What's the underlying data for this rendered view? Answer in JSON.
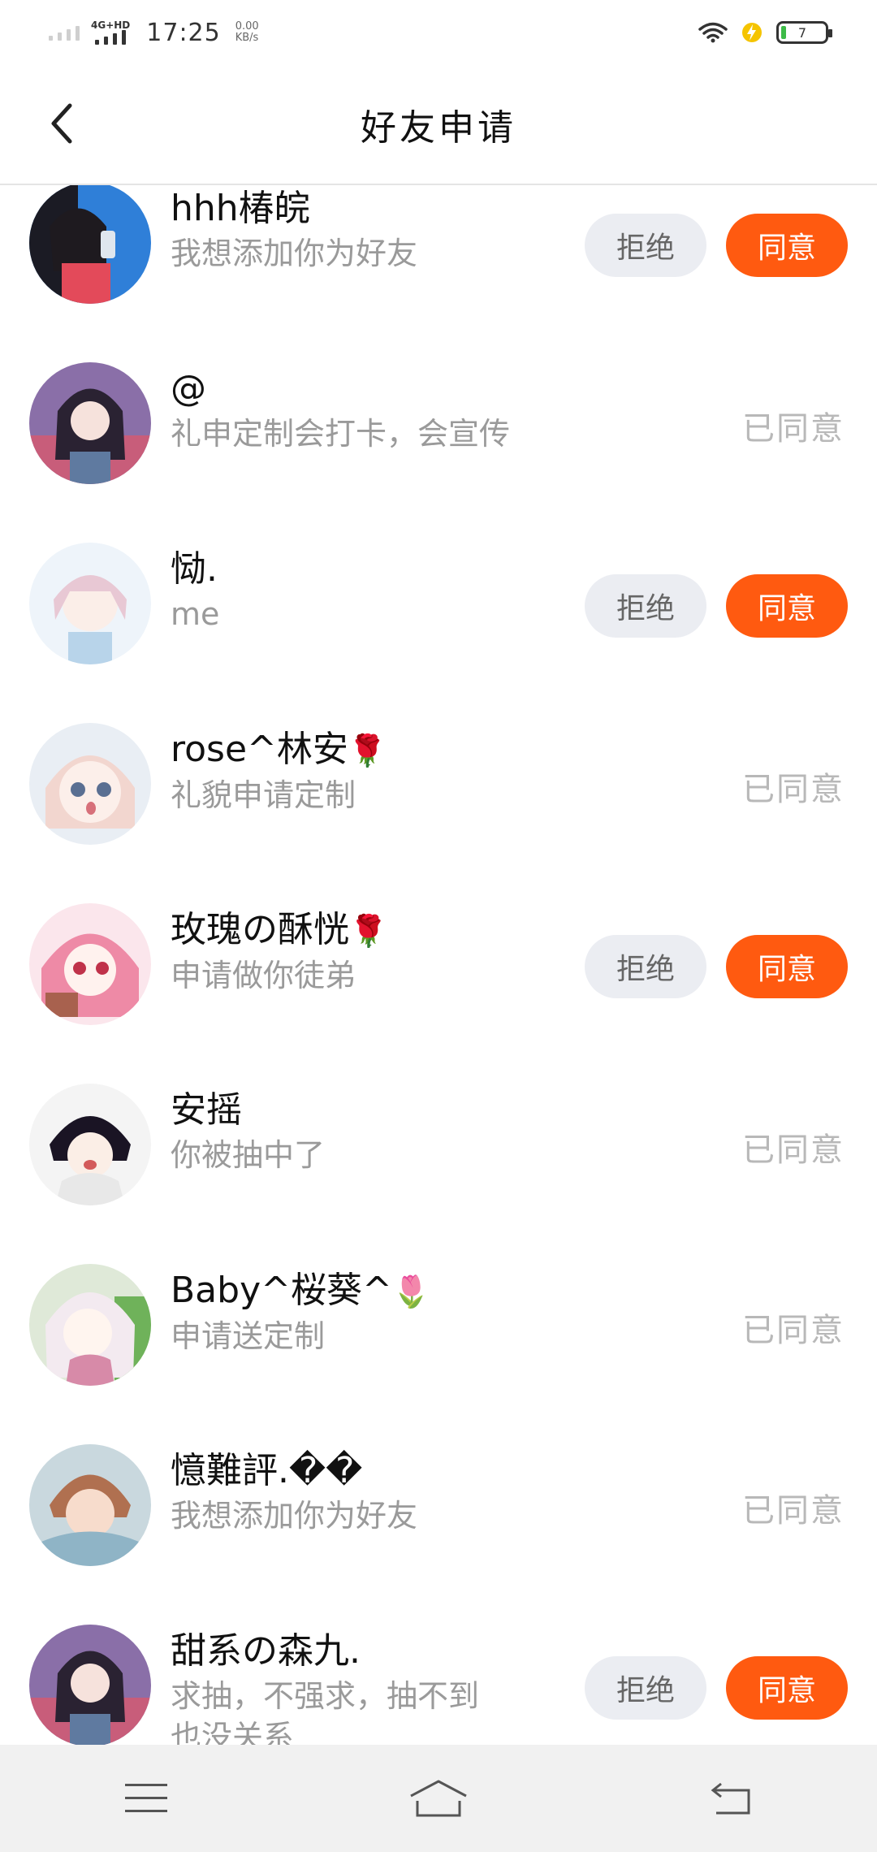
{
  "status_bar": {
    "network": "4G+HD",
    "time": "17:25",
    "speed_value": "0.00",
    "speed_unit": "KB/s",
    "battery": "7"
  },
  "header": {
    "title": "好友申请"
  },
  "colors": {
    "accent": "#ff5a10",
    "reject_bg": "#ebedf2",
    "muted_text": "#9a9a9a",
    "status_text": "#b8b8b8"
  },
  "requests": [
    {
      "name": "hhh椿皖",
      "message": "我想添加你为好友",
      "state": "pending",
      "reject_label": "拒绝",
      "accept_label": "同意"
    },
    {
      "name": "@",
      "message": "礼申定制会打卡，会宣传",
      "state": "accepted",
      "status_label": "已同意"
    },
    {
      "name": "恸.",
      "message": "me",
      "state": "pending",
      "reject_label": "拒绝",
      "accept_label": "同意"
    },
    {
      "name": "rose^林安",
      "emoji": "🌹",
      "message": "礼貌申请定制",
      "state": "accepted",
      "status_label": "已同意"
    },
    {
      "name": "玫瑰の酥恍",
      "emoji": "🌹",
      "message": "申请做你徒弟",
      "state": "pending",
      "reject_label": "拒绝",
      "accept_label": "同意"
    },
    {
      "name": "安摇",
      "message": "你被抽中了",
      "state": "accepted",
      "status_label": "已同意"
    },
    {
      "name": "Baby^桜葵^",
      "emoji": "🌷",
      "message": "申请送定制",
      "state": "accepted",
      "status_label": "已同意"
    },
    {
      "name": "憶難評.��",
      "message": "我想添加你为好友",
      "state": "accepted",
      "status_label": "已同意"
    },
    {
      "name": "甜系の森九.",
      "message": "求抽，不强求，抽不到",
      "message_line2": "也没关系",
      "state": "pending",
      "reject_label": "拒绝",
      "accept_label": "同意"
    }
  ],
  "bottom_nav": {
    "icons": [
      "menu-icon",
      "home-icon",
      "back-nav-icon"
    ]
  }
}
